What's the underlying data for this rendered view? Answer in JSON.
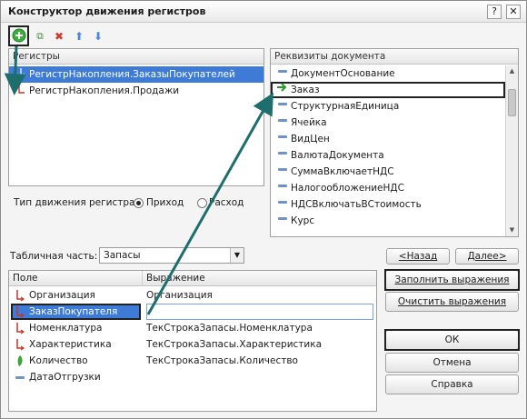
{
  "window": {
    "title": "Конструктор движения регистров",
    "help_glyph": "?",
    "close_glyph": "✕"
  },
  "toolbar": {
    "add_icon": "add-circle-icon",
    "add_glyph": "+",
    "copy_glyph": "⧉",
    "delete_glyph": "✖",
    "up_glyph": "⬆",
    "down_glyph": "⬇"
  },
  "registers": {
    "header": "Регистры",
    "items": [
      {
        "label": "РегистрНакопления.ЗаказыПокупателей",
        "selected": true
      },
      {
        "label": "РегистрНакопления.Продажи",
        "selected": false
      }
    ]
  },
  "movement_type": {
    "label": "Тип движения регистра:",
    "options": [
      "Приход",
      "Расход"
    ],
    "selected": "Приход"
  },
  "requisites": {
    "header": "Реквизиты документа",
    "items": [
      "ДокументОснование",
      "Заказ",
      "СтруктурнаяЕдиница",
      "Ячейка",
      "ВидЦен",
      "ВалютаДокумента",
      "СуммаВключаетНДС",
      "НалогообложениеНДС",
      "НДСВключатьВСтоимость",
      "Курс"
    ]
  },
  "tabular": {
    "label": "Табличная часть:",
    "value": "Запасы"
  },
  "grid": {
    "col_field": "Поле",
    "col_expr": "Выражение",
    "rows": [
      {
        "field": "Организация",
        "expr": "Организация",
        "icon": "dimension-icon"
      },
      {
        "field": "ЗаказПокупателя",
        "expr": "",
        "icon": "dimension-icon"
      },
      {
        "field": "Номенклатура",
        "expr": "ТекСтрокаЗапасы.Номенклатура",
        "icon": "dimension-icon"
      },
      {
        "field": "Характеристика",
        "expr": "ТекСтрокаЗапасы.Характеристика",
        "icon": "dimension-icon"
      },
      {
        "field": "Количество",
        "expr": "ТекСтрокаЗапасы.Количество",
        "icon": "resource-icon"
      },
      {
        "field": "ДатаОтгрузки",
        "expr": "",
        "icon": "attribute-icon"
      }
    ]
  },
  "buttons": {
    "back": "<Назад",
    "next": "Далее>",
    "fill": "Заполнить выражения",
    "clear": "Очистить выражения",
    "ok": "ОК",
    "cancel": "Отмена",
    "help": "Справка"
  },
  "colors": {
    "selection": "#3d7bd6",
    "arrow": "#1e6e6e",
    "add_green": "#3cae3c",
    "delete_red": "#d23a2a",
    "arrow_blue": "#4a86d8"
  }
}
